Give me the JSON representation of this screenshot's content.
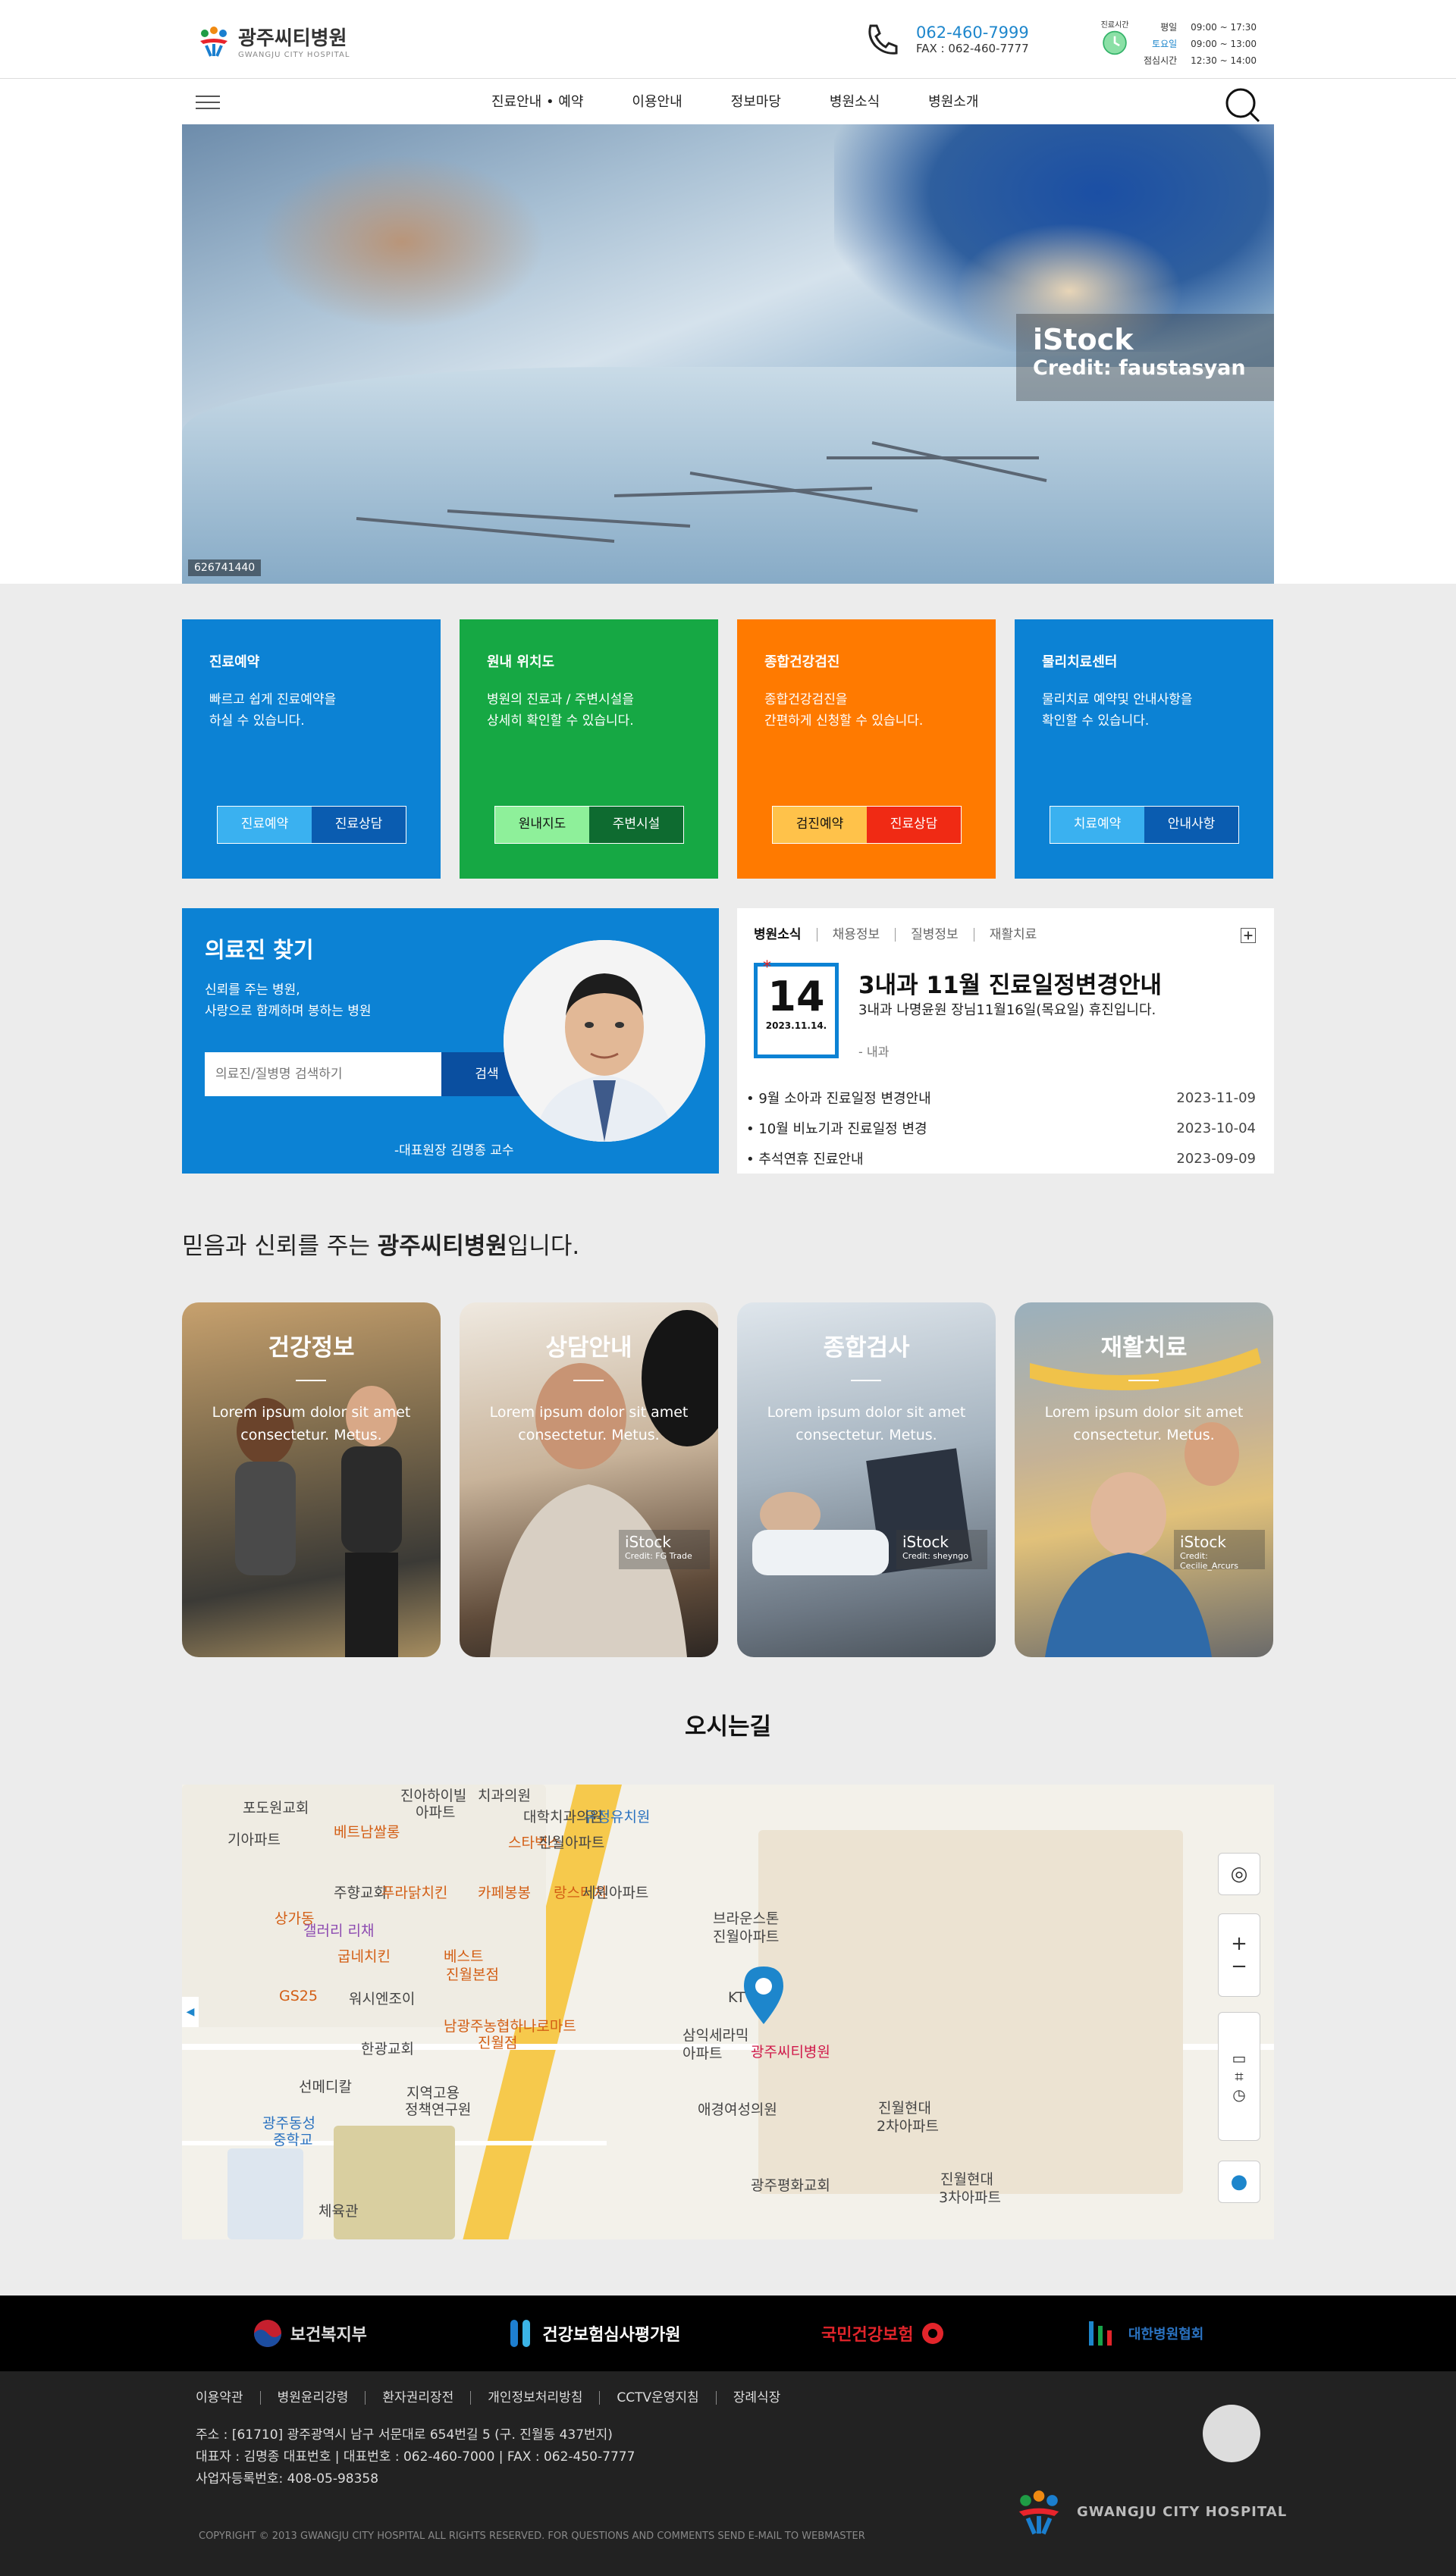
{
  "header": {
    "logo_text": "광주씨티병원",
    "logo_sub": "GWANGJU CITY HOSPITAL",
    "phone": "062-460-7999",
    "fax": "FAX : 062-460-7777",
    "hours_label": "진료시간",
    "hours": [
      {
        "day": "평일",
        "time": "09:00 ~ 17:30"
      },
      {
        "day": "토요일",
        "time": "09:00 ~ 13:00"
      },
      {
        "day": "점심시간",
        "time": "12:30 ~ 14:00"
      }
    ]
  },
  "nav": {
    "items": [
      "진료안내 • 예약",
      "이용안내",
      "정보마당",
      "병원소식",
      "병원소개"
    ]
  },
  "hero": {
    "watermark_brand": "iStock",
    "watermark_credit": "Credit: faustasyan",
    "stock_id": "626741440"
  },
  "services": [
    {
      "title": "진료예약",
      "desc1": "빠르고 쉽게 진료예약을",
      "desc2": "하실 수 있습니다.",
      "btn1": "진료예약",
      "btn2": "진료상담",
      "color": "#0c82d4",
      "btn1_bg": "#3ab1f0",
      "btn2_bg": "#0a5cb0"
    },
    {
      "title": "원내 위치도",
      "desc1": "병원의 진료과 / 주변시설을",
      "desc2": "상세히 확인할 수 있습니다.",
      "btn1": "원내지도",
      "btn2": "주변시설",
      "color": "#16a844",
      "btn1_bg": "#8ef09a",
      "btn2_bg": "#0e6b30"
    },
    {
      "title": "종합건강검진",
      "desc1": "종합건강검진을",
      "desc2": "간편하게 신청할 수 있습니다.",
      "btn1": "검진예약",
      "btn2": "진료상담",
      "color": "#ff7a00",
      "btn1_bg": "#ffc24a",
      "btn2_bg": "#f02a14"
    },
    {
      "title": "물리치료센터",
      "desc1": "물리치료 예약및 안내사항을",
      "desc2": "확인할 수 있습니다.",
      "btn1": "치료예약",
      "btn2": "안내사항",
      "color": "#0c82d4",
      "btn1_bg": "#3ab1f0",
      "btn2_bg": "#0a5cb0"
    }
  ],
  "doctor": {
    "title": "의료진 찾기",
    "desc1": "신뢰를 주는 병원,",
    "desc2": "사랑으로 함께하며 봉하는 병원",
    "placeholder": "의료진/질병명 검색하기",
    "search_btn": "검색",
    "caption": "-대표원장 김명종 교수"
  },
  "news": {
    "tabs": [
      "병원소식",
      "채용정보",
      "질병정보",
      "재활치료"
    ],
    "day": "14",
    "full_date": "2023.11.14.",
    "headline": "3내과 11월 진료일정변경안내",
    "sub": "3내과 나명윤원 장님11월16일(목요일) 휴진입니다.",
    "category": "- 내과",
    "items": [
      {
        "title": "9월 소아과 진료일정 변경안내",
        "date": "2023-11-09"
      },
      {
        "title": "10월 비뇨기과 진료일정 변경",
        "date": "2023-10-04"
      },
      {
        "title": "추석연휴 진료안내",
        "date": "2023-09-09"
      }
    ]
  },
  "tagline": {
    "pre": "믿음과 신뢰를 주는 ",
    "bold": "광주씨티병원",
    "post": "입니다."
  },
  "cards": [
    {
      "title": "건강정보",
      "desc1": "Lorem ipsum dolor sit amet",
      "desc2": "consectetur. Metus.",
      "stock": "",
      "credit": ""
    },
    {
      "title": "상담안내",
      "desc1": "Lorem ipsum dolor sit amet",
      "desc2": "consectetur. Metus.",
      "stock": "iStock",
      "credit": "Credit: FG Trade"
    },
    {
      "title": "종합검사",
      "desc1": "Lorem ipsum dolor sit amet",
      "desc2": "consectetur. Metus.",
      "stock": "iStock",
      "credit": "Credit: sheyngo"
    },
    {
      "title": "재활치료",
      "desc1": "Lorem ipsum dolor sit amet",
      "desc2": "consectetur. Metus.",
      "stock": "iStock",
      "credit": "Credit: Cecilie_Arcurs"
    }
  ],
  "map": {
    "title": "오시는길",
    "labels": [
      {
        "t": "포도원교회",
        "c": ""
      },
      {
        "t": "진아하이빌",
        "c": ""
      },
      {
        "t": "아파트",
        "c": ""
      },
      {
        "t": "치과의원",
        "c": ""
      },
      {
        "t": "유정유치원",
        "c": "b"
      },
      {
        "t": "대학치과의원",
        "c": ""
      },
      {
        "t": "베트남쌀롱",
        "c": "o"
      },
      {
        "t": "스타벅스",
        "c": "o"
      },
      {
        "t": "진월아파트",
        "c": ""
      },
      {
        "t": "기아파트",
        "c": ""
      },
      {
        "t": "주향교회",
        "c": ""
      },
      {
        "t": "푸라닭치킨",
        "c": "o"
      },
      {
        "t": "카페봉봉",
        "c": "o"
      },
      {
        "t": "랑스터치",
        "c": "o"
      },
      {
        "t": "세원아파트",
        "c": ""
      },
      {
        "t": "상가동",
        "c": "o"
      },
      {
        "t": "갤러리 리채",
        "c": "g"
      },
      {
        "t": "브라운스톤",
        "c": ""
      },
      {
        "t": "진월아파트",
        "c": ""
      },
      {
        "t": "굽네치킨",
        "c": "o"
      },
      {
        "t": "베스트",
        "c": "o"
      },
      {
        "t": "진월본점",
        "c": "o"
      },
      {
        "t": "GS25",
        "c": "o"
      },
      {
        "t": "워시엔조이",
        "c": ""
      },
      {
        "t": "KT",
        "c": ""
      },
      {
        "t": "남광주농협하나로마트",
        "c": "o"
      },
      {
        "t": "진월점",
        "c": "o"
      },
      {
        "t": "광주씨티병원",
        "c": "p"
      },
      {
        "t": "삼익세라믹",
        "c": ""
      },
      {
        "t": "아파트",
        "c": ""
      },
      {
        "t": "한광교회",
        "c": ""
      },
      {
        "t": "선메디칼",
        "c": ""
      },
      {
        "t": "지역고용",
        "c": ""
      },
      {
        "t": "정책연구원",
        "c": ""
      },
      {
        "t": "애경여성의원",
        "c": ""
      },
      {
        "t": "진월현대",
        "c": ""
      },
      {
        "t": "2차아파트",
        "c": ""
      },
      {
        "t": "광주동성",
        "c": "b"
      },
      {
        "t": "중학교",
        "c": "b"
      },
      {
        "t": "광주평화교회",
        "c": ""
      },
      {
        "t": "진월현대",
        "c": ""
      },
      {
        "t": "3차아파트",
        "c": ""
      },
      {
        "t": "체육관",
        "c": ""
      }
    ]
  },
  "partners": [
    "보건복지부",
    "건강보험심사평가원",
    "국민건강보험",
    "대한병원협회"
  ],
  "footer": {
    "links": [
      "이용약관",
      "병원윤리강령",
      "환자권리장전",
      "개인정보처리방침",
      "CCTV운영지침",
      "장례식장"
    ],
    "address": "주소 : [61710] 광주광역시 남구 서문대로 654번길 5 (구. 진월동 437번지)",
    "rep": "대표자 : 김명종 대표번호 | 대표번호 : 062-460-7000 | FAX : 062-450-7777",
    "biz": "사업자등록번호: 408-05-98358",
    "copyright": "COPYRIGHT © 2013 GWANGJU CITY HOSPITAL ALL RIGHTS RESERVED. FOR QUESTIONS AND COMMENTS SEND E-MAIL TO WEBMASTER",
    "logo_text": "GWANGJU CITY HOSPITAL"
  }
}
